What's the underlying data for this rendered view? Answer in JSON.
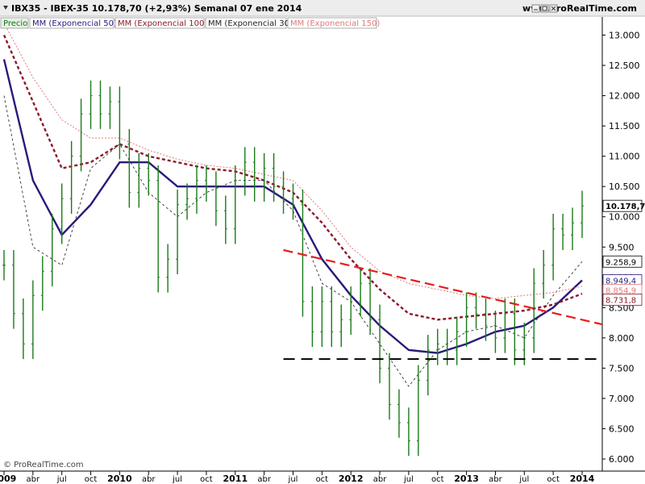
{
  "header": {
    "title": "IBX35 - IBEX-35   10.178,70 (+2,93%)   Semanal  07 ene 2014",
    "site": "www.ProRealTime.com"
  },
  "legend": [
    {
      "label": "Precio",
      "color": "#1a6e1a",
      "bg": "#e6f2e6"
    },
    {
      "label": "MM (Exponencial 50)",
      "color": "#2a1a7a",
      "bg": "#ffffff"
    },
    {
      "label": "MM (Exponencial 100)",
      "color": "#8b1a2a",
      "bg": "#ffffff"
    },
    {
      "label": "MM (Exponencial 30)",
      "color": "#222222",
      "bg": "#ffffff"
    },
    {
      "label": "MM (Exponencial 150)",
      "color": "#e07a7a",
      "bg": "#ffffff"
    }
  ],
  "copyright": "© ProRealTime.com",
  "colors": {
    "price_bar": "#1a7a1a",
    "ema50": "#2a1a7a",
    "ema100": "#8b1a2a",
    "ema30": "#333333",
    "ema150": "#e07a7a",
    "trendline": "#e81c1c",
    "support": "#000000"
  },
  "chart_data": {
    "type": "line",
    "ylim": [
      5.8,
      13.3
    ],
    "yticks": [
      "13.000",
      "12.500",
      "12.000",
      "11.500",
      "11.000",
      "10.500",
      "10.000",
      "9.500",
      "9.000",
      "8.500",
      "8.000",
      "7.500",
      "7.000",
      "6.500",
      "6.000"
    ],
    "ytick_values": [
      13.0,
      12.5,
      12.0,
      11.5,
      11.0,
      10.5,
      10.0,
      9.5,
      9.0,
      8.5,
      8.0,
      7.5,
      7.0,
      6.5,
      6.0
    ],
    "x_range": [
      "2009-01",
      "2014-01"
    ],
    "xticks": [
      {
        "label": "2009",
        "t": "2009-01",
        "year": true
      },
      {
        "label": "abr",
        "t": "2009-04",
        "year": false
      },
      {
        "label": "jul",
        "t": "2009-07",
        "year": false
      },
      {
        "label": "oct",
        "t": "2009-10",
        "year": false
      },
      {
        "label": "2010",
        "t": "2010-01",
        "year": true
      },
      {
        "label": "abr",
        "t": "2010-04",
        "year": false
      },
      {
        "label": "jul",
        "t": "2010-07",
        "year": false
      },
      {
        "label": "oct",
        "t": "2010-10",
        "year": false
      },
      {
        "label": "2011",
        "t": "2011-01",
        "year": true
      },
      {
        "label": "abr",
        "t": "2011-04",
        "year": false
      },
      {
        "label": "jul",
        "t": "2011-07",
        "year": false
      },
      {
        "label": "oct",
        "t": "2011-10",
        "year": false
      },
      {
        "label": "2012",
        "t": "2012-01",
        "year": true
      },
      {
        "label": "abr",
        "t": "2012-04",
        "year": false
      },
      {
        "label": "jul",
        "t": "2012-07",
        "year": false
      },
      {
        "label": "oct",
        "t": "2012-10",
        "year": false
      },
      {
        "label": "2013",
        "t": "2013-01",
        "year": true
      },
      {
        "label": "abr",
        "t": "2013-04",
        "year": false
      },
      {
        "label": "jul",
        "t": "2013-07",
        "year": false
      },
      {
        "label": "oct",
        "t": "2013-10",
        "year": false
      },
      {
        "label": "2014",
        "t": "2014-01",
        "year": true
      }
    ],
    "value_labels": [
      {
        "text": "10.178,70",
        "value": 10.18,
        "color": "#000000",
        "bg": "#ffffff",
        "bold": true
      },
      {
        "text": "9.258,9",
        "value": 9.26,
        "color": "#000000",
        "bg": "#ffffff",
        "bold": false
      },
      {
        "text": "8.949,4",
        "value": 8.95,
        "color": "#2a1a7a",
        "bg": "#ffffff",
        "bold": false
      },
      {
        "text": "8.854,9",
        "value": 8.85,
        "color": "#e07a7a",
        "bg": "#ffffff",
        "bold": false
      },
      {
        "text": "8.731,8",
        "value": 8.73,
        "color": "#8b1a2a",
        "bg": "#ffffff",
        "bold": false
      }
    ],
    "price_series": {
      "name": "Precio",
      "type": "ohlc",
      "t": [
        "2009-01",
        "2009-02",
        "2009-03",
        "2009-04",
        "2009-05",
        "2009-06",
        "2009-07",
        "2009-08",
        "2009-09",
        "2009-10",
        "2009-11",
        "2009-12",
        "2010-01",
        "2010-02",
        "2010-03",
        "2010-04",
        "2010-05",
        "2010-06",
        "2010-07",
        "2010-08",
        "2010-09",
        "2010-10",
        "2010-11",
        "2010-12",
        "2011-01",
        "2011-02",
        "2011-03",
        "2011-04",
        "2011-05",
        "2011-06",
        "2011-07",
        "2011-08",
        "2011-09",
        "2011-10",
        "2011-11",
        "2011-12",
        "2012-01",
        "2012-02",
        "2012-03",
        "2012-04",
        "2012-05",
        "2012-06",
        "2012-07",
        "2012-08",
        "2012-09",
        "2012-10",
        "2012-11",
        "2012-12",
        "2013-01",
        "2013-02",
        "2013-03",
        "2013-04",
        "2013-05",
        "2013-06",
        "2013-07",
        "2013-08",
        "2013-09",
        "2013-10",
        "2013-11",
        "2013-12",
        "2014-01"
      ],
      "close": [
        9.2,
        8.4,
        7.9,
        8.7,
        9.1,
        9.8,
        10.3,
        11.0,
        11.7,
        12.0,
        11.7,
        11.9,
        11.2,
        10.4,
        10.8,
        10.6,
        9.0,
        9.3,
        10.2,
        10.3,
        10.6,
        10.5,
        10.1,
        9.8,
        10.6,
        10.9,
        10.5,
        10.8,
        10.5,
        10.3,
        10.2,
        8.6,
        8.1,
        8.6,
        8.1,
        8.3,
        8.6,
        8.9,
        8.3,
        7.5,
        6.9,
        6.6,
        6.3,
        7.3,
        7.8,
        7.9,
        7.8,
        8.1,
        8.5,
        8.4,
        8.2,
        8.0,
        8.4,
        7.8,
        8.0,
        8.9,
        9.2,
        9.8,
        9.7,
        9.9,
        10.18
      ]
    },
    "series": [
      {
        "name": "MM (Exponencial 50)",
        "style": "solid-thick",
        "t": [
          "2009-01",
          "2009-04",
          "2009-07",
          "2009-10",
          "2010-01",
          "2010-04",
          "2010-07",
          "2010-10",
          "2011-01",
          "2011-04",
          "2011-07",
          "2011-10",
          "2012-01",
          "2012-04",
          "2012-07",
          "2012-10",
          "2013-01",
          "2013-04",
          "2013-07",
          "2013-10",
          "2014-01"
        ],
        "values": [
          12.6,
          10.6,
          9.7,
          10.2,
          10.9,
          10.9,
          10.5,
          10.5,
          10.5,
          10.5,
          10.2,
          9.3,
          8.7,
          8.2,
          7.8,
          7.75,
          7.9,
          8.1,
          8.2,
          8.5,
          8.95
        ]
      },
      {
        "name": "MM (Exponencial 100)",
        "style": "dotted-thick",
        "t": [
          "2009-01",
          "2009-04",
          "2009-07",
          "2009-10",
          "2010-01",
          "2010-04",
          "2010-07",
          "2010-10",
          "2011-01",
          "2011-04",
          "2011-07",
          "2011-10",
          "2012-01",
          "2012-04",
          "2012-07",
          "2012-10",
          "2013-01",
          "2013-04",
          "2013-07",
          "2013-10",
          "2014-01"
        ],
        "values": [
          13.0,
          11.9,
          10.8,
          10.9,
          11.2,
          11.0,
          10.9,
          10.8,
          10.75,
          10.6,
          10.4,
          9.9,
          9.3,
          8.8,
          8.4,
          8.3,
          8.35,
          8.4,
          8.45,
          8.55,
          8.73
        ]
      },
      {
        "name": "MM (Exponencial 30)",
        "style": "dashed-thin",
        "t": [
          "2009-01",
          "2009-04",
          "2009-07",
          "2009-10",
          "2010-01",
          "2010-04",
          "2010-07",
          "2010-10",
          "2011-01",
          "2011-04",
          "2011-07",
          "2011-10",
          "2012-01",
          "2012-04",
          "2012-07",
          "2012-10",
          "2013-01",
          "2013-04",
          "2013-07",
          "2013-10",
          "2014-01"
        ],
        "values": [
          12.0,
          9.5,
          9.2,
          10.8,
          11.2,
          10.4,
          10.0,
          10.4,
          10.6,
          10.6,
          10.1,
          8.9,
          8.6,
          7.9,
          7.2,
          7.8,
          8.1,
          8.2,
          8.0,
          8.7,
          9.26
        ]
      },
      {
        "name": "MM (Exponencial 150)",
        "style": "dotted-thin",
        "t": [
          "2009-01",
          "2009-04",
          "2009-07",
          "2009-10",
          "2010-01",
          "2010-04",
          "2010-07",
          "2010-10",
          "2011-01",
          "2011-04",
          "2011-07",
          "2011-10",
          "2012-01",
          "2012-04",
          "2012-07",
          "2012-10",
          "2013-01",
          "2013-04",
          "2013-07",
          "2013-10",
          "2014-01"
        ],
        "values": [
          13.2,
          12.3,
          11.6,
          11.3,
          11.3,
          11.1,
          10.95,
          10.85,
          10.8,
          10.7,
          10.6,
          10.1,
          9.5,
          9.1,
          8.9,
          8.8,
          8.7,
          8.65,
          8.7,
          8.75,
          8.85
        ]
      }
    ],
    "annotations": [
      {
        "type": "trendline",
        "style": "dashed",
        "t": [
          "2011-06",
          "2014-01"
        ],
        "values": [
          9.45,
          8.3
        ]
      },
      {
        "type": "support",
        "style": "dashed",
        "t": [
          "2011-06",
          "2014-01"
        ],
        "values": [
          7.65,
          7.65
        ]
      }
    ]
  }
}
